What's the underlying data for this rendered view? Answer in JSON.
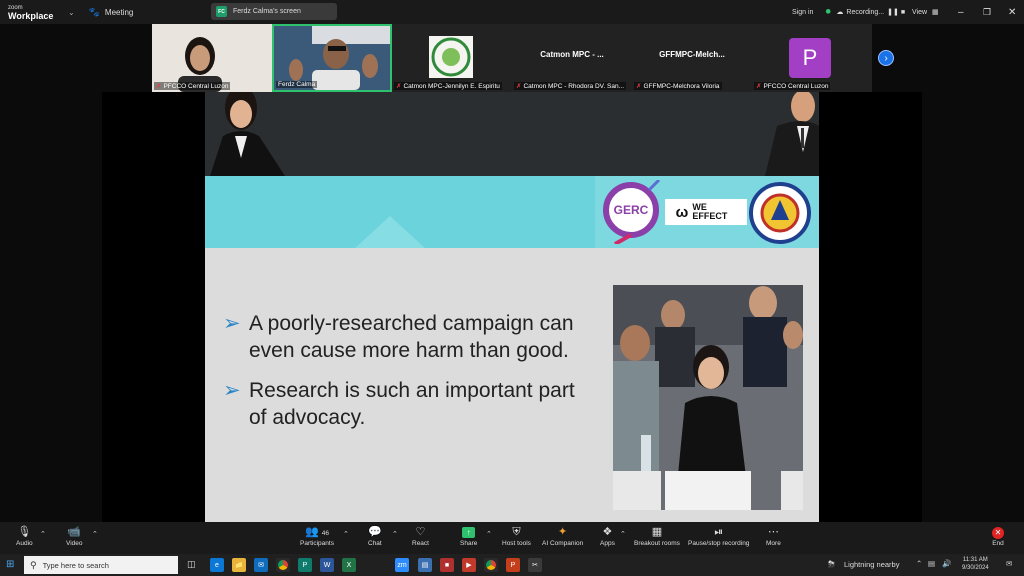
{
  "topbar": {
    "brand_line1": "zoom",
    "brand_line2": "Workplace",
    "meeting_label": "Meeting",
    "share_chip": "Ferdz Calma's screen",
    "share_chip_badge": "FC",
    "signin": "Sign in",
    "recording": "Recording...",
    "view": "View"
  },
  "gallery": {
    "tiles": [
      {
        "name": "PFCCO Central Luzon"
      },
      {
        "name": "Ferdz Calma"
      },
      {
        "name": "Catmon MPC-Jennilyn E. Espiritu"
      },
      {
        "title": "Catmon  MPC - ...",
        "name": "Catmon MPC - Rhodora DV. San..."
      },
      {
        "title": "GFFMPC-Melch...",
        "name": "GFFMPC-Melchora Viloria"
      },
      {
        "avatar": "P",
        "name": "PFCCO Central Luzon"
      }
    ]
  },
  "slide": {
    "logos": {
      "gerc": "GERC",
      "we_effect": "WE EFFECT"
    },
    "bullets": [
      "A poorly-researched campaign can even cause more harm than good.",
      "Research is such an important part of advocacy."
    ]
  },
  "toolbar": {
    "audio": "Audio",
    "video": "Video",
    "participants": "Participants",
    "participants_count": "46",
    "chat": "Chat",
    "react": "React",
    "share": "Share",
    "host_tools": "Host tools",
    "ai_companion": "AI Companion",
    "apps": "Apps",
    "breakout": "Breakout rooms",
    "pause_record": "Pause/stop recording",
    "more": "More",
    "end": "End"
  },
  "taskbar": {
    "search_placeholder": "Type here to search",
    "weather": "Lightning nearby",
    "time": "11:31 AM",
    "date": "9/30/2024"
  },
  "colors": {
    "accent_green": "#2ec26f",
    "teal": "#6ad3db",
    "avatar_purple": "#a23fc4",
    "blue": "#1a72e8"
  }
}
